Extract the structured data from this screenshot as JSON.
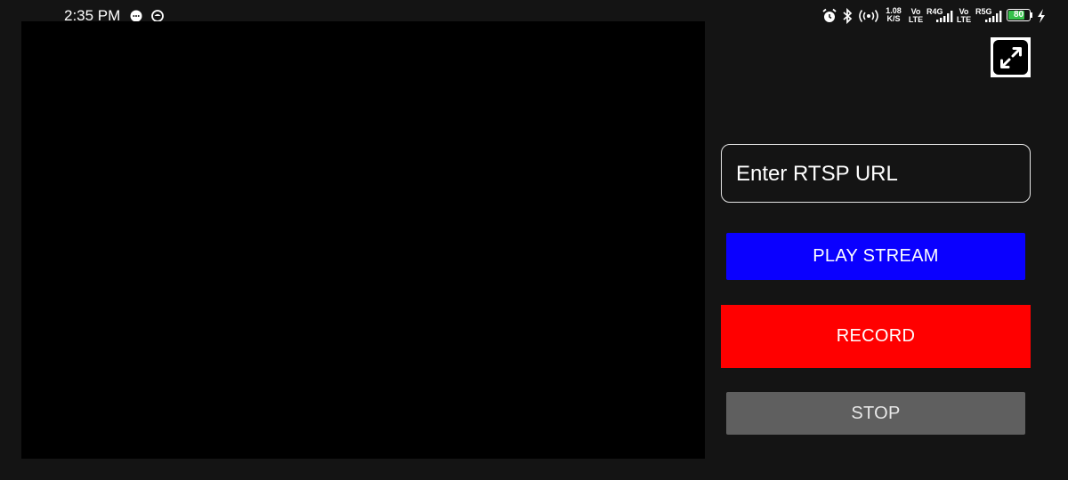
{
  "status_bar": {
    "time": "2:35 PM",
    "net_speed_value": "1.08",
    "net_speed_unit": "K/S",
    "sim1_vo": "Vo",
    "sim1_lte": "LTE",
    "sim1_network": "R4G",
    "sim2_vo": "Vo",
    "sim2_lte": "LTE",
    "sim2_network": "R5G",
    "battery_level": "80",
    "battery_color": "#35c14a",
    "icons": [
      "chat-bubble-icon",
      "smiley-icon",
      "alarm-icon",
      "bluetooth-icon",
      "hotspot-icon",
      "signal-icon",
      "battery-icon",
      "charging-icon"
    ]
  },
  "controls": {
    "url_placeholder": "Enter RTSP URL",
    "url_value": "",
    "play_label": "PLAY STREAM",
    "record_label": "RECORD",
    "stop_label": "STOP",
    "fullscreen_icon": "expand-arrows-icon"
  },
  "colors": {
    "background": "#141414",
    "video": "#000000",
    "play": "#0a00ff",
    "record": "#ff0000",
    "stop": "#5f5f5f"
  }
}
